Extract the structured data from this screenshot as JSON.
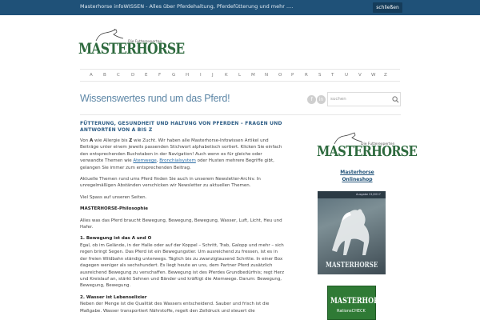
{
  "topbar": {
    "message": "Masterhorse infoWISSEN - Alles über Pferdehaltung, Pferdefütterung und mehr ....",
    "close_label": "schließen"
  },
  "header": {
    "logo_text": "MASTERHORSE",
    "logo_tagline": "Die Futterexperten"
  },
  "alphabet": [
    "A",
    "B",
    "C",
    "D",
    "E",
    "F",
    "G",
    "H",
    "I",
    "J",
    "K",
    "L",
    "M",
    "N",
    "O",
    "P",
    "R",
    "S",
    "T",
    "U",
    "V",
    "W",
    "Z"
  ],
  "page": {
    "title": "Wissenswertes rund um das Pferd!",
    "search_placeholder": "suchen",
    "social": [
      "f",
      "in"
    ]
  },
  "article": {
    "heading": "FÜTTERUNG, GESUNDHEIT UND HALTUNG VON PFERDEN – FRAGEN UND ANTWORTEN VON A BIS Z",
    "p1": {
      "t1": "Von ",
      "a": "A",
      "t2": " wie Allergie bis ",
      "z": "Z",
      "t3": " wie Zucht. Wir haben alle Masterhorse-Infowissen Artikel und Beiträge unter einem jeweils passenden Stichwort alphabetisch sortiert. Klicken Sie einfach den entsprechenden Buchstaben in der Navigation! Auch wenn es für gleiche oder verwandte Themen wie ",
      "link1": "Atemwege",
      "t4": ", ",
      "link2": "Bronchialsystem",
      "t5": " oder Husten mehrere Begriffe gibt, gelangen Sie immer zum entsprechenden Beitrag."
    },
    "p2": "Aktuelle Themen rund ums Pferd finden Sie auch in unserem Newsletter-Archiv. In unregelmäßigen Abständen verschicken wir Newsletter zu aktuellen Themen.",
    "p3": "Viel Spass auf unseren Seiten.",
    "philosophy_title": "MASTERHORSE-Philosophie",
    "p4": "Alles was das Pferd braucht Bewegung, Bewegung, Bewegung, Wasser, Luft, Licht, Heu und Hafer.",
    "s1_title": "1. Bewegung ist das A und O",
    "s1_text": "Egal, ob im Gelände, in der Halle oder auf der Koppel – Schritt, Trab, Galopp und mehr – sich regen bringt Segen. Das Pferd ist ein Bewegungstier. Um ausreichend zu fressen, ist es in der freien Wildbahn ständig unterwegs. Täglich bis zu zwanzigtausend Schritte. In einer Box dagegen weniger als sechshundert. Es liegt heute an uns, dem Partner Pferd zusätzlich ausreichend Bewegung zu verschaffen. Bewegung ist des Pferdes Grundbedürfnis; regt Herz und Kreislauf an, stärkt Sehnen und Bänder und kräftigt die Atemwege. Darum: Bewegung, Bewegung, Bewegung.",
    "s2_title": "2. Wasser ist Lebenselixier",
    "s2_text": "Neben der Menge ist die Qualität des Wassers entscheidend. Sauber und frisch ist die Maßgabe. Wasser transportiert Nährstoffe, regelt den Zelldruck und steuert die"
  },
  "sidebar": {
    "logo_text": "MASTERHORSE",
    "logo_tagline": "Die Futterexperten",
    "shop_line1": "Masterhorse",
    "shop_line2": "Onlineshop",
    "magazine_title": "MASTERHORSE",
    "magazine_date": "Ausgabe 01/2017",
    "rations_brand": "MASTERHORSE",
    "rations_sub": "RationsCHECK"
  },
  "colors": {
    "topbar": "#1f5178",
    "brand_green": "#2e6a3e",
    "heading_blue": "#2d5d86",
    "title_blue": "#5c86a6",
    "link": "#2d6ea6"
  }
}
